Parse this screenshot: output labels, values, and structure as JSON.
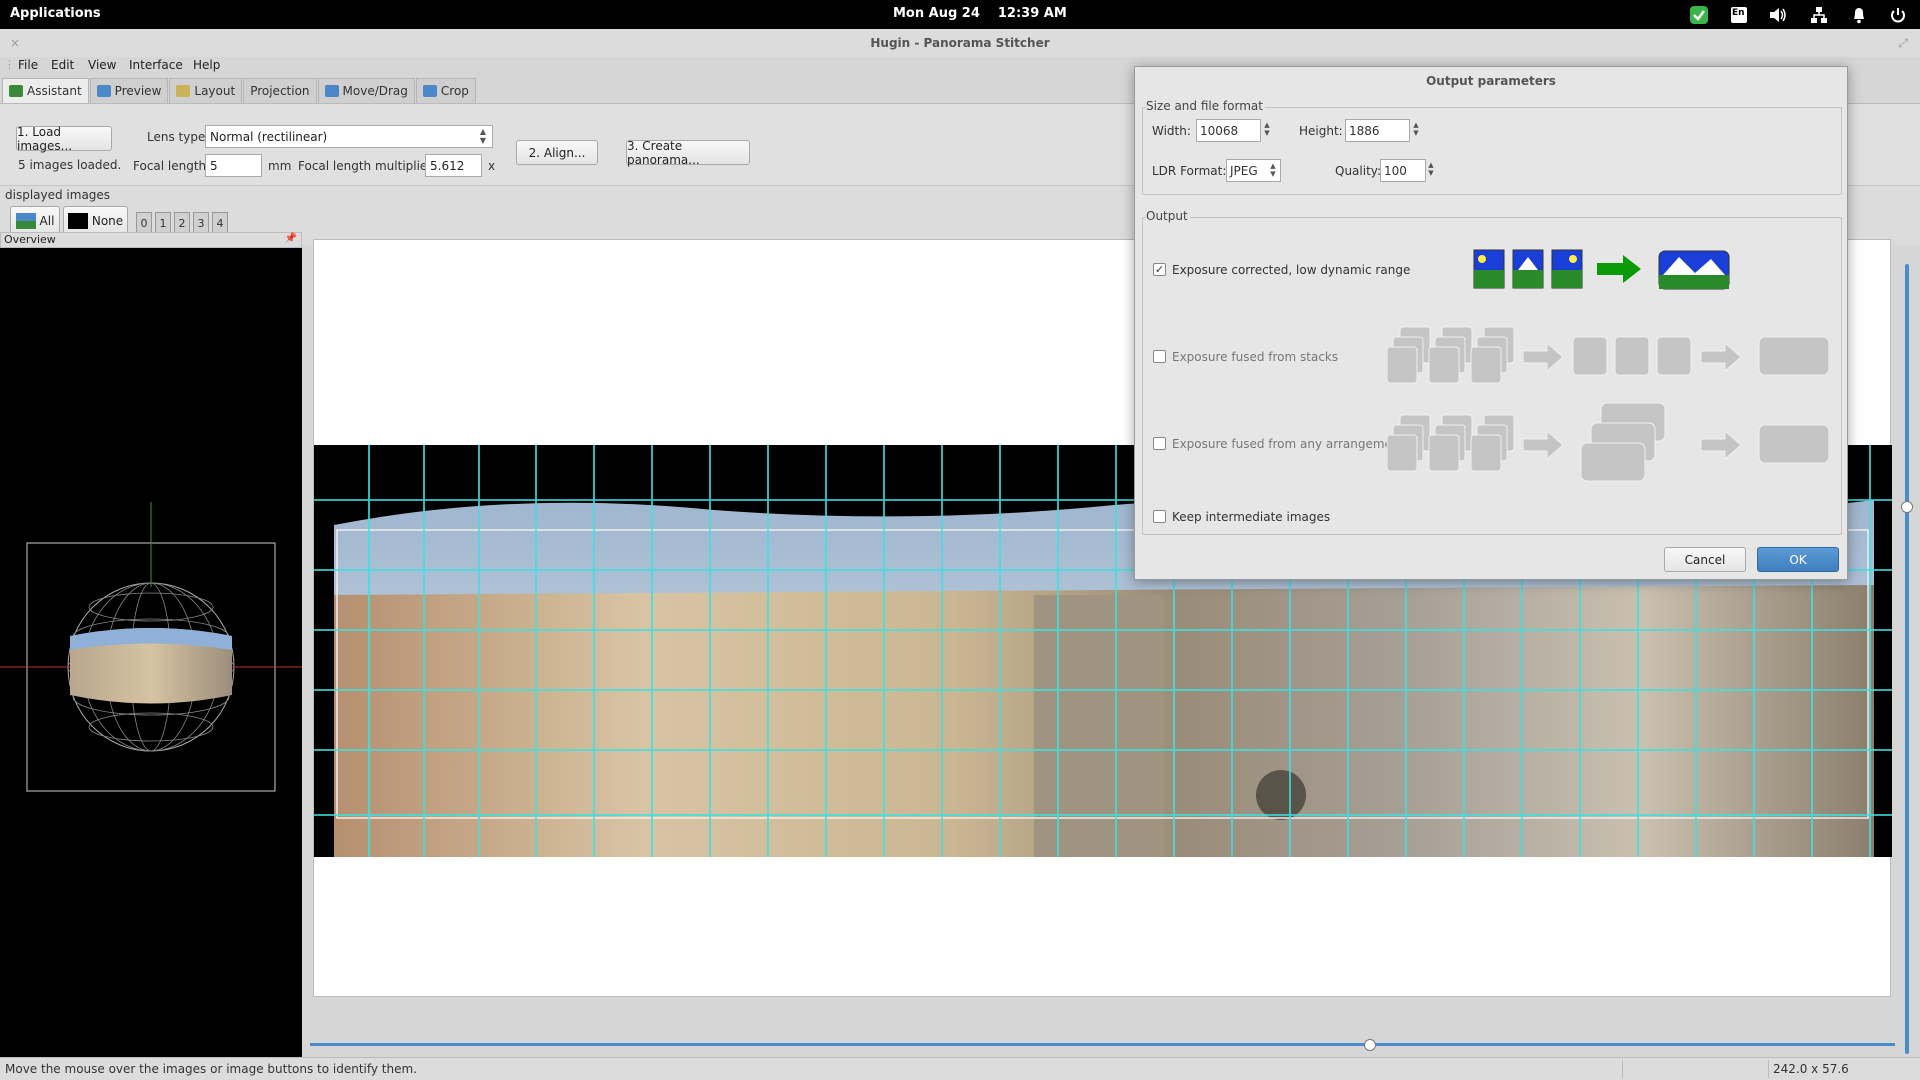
{
  "topbar": {
    "applications": "Applications",
    "date": "Mon Aug 24",
    "time": "12:39 AM",
    "tray": [
      "shield-check-icon",
      "keyboard-layout-icon",
      "volume-icon",
      "network-icon",
      "notification-bell-icon",
      "power-icon"
    ],
    "keyboard_layout": "En"
  },
  "window": {
    "title": "Hugin - Panorama Stitcher"
  },
  "menu": [
    "File",
    "Edit",
    "View",
    "Interface",
    "Help"
  ],
  "tabs": [
    "Assistant",
    "Preview",
    "Layout",
    "Projection",
    "Move/Drag",
    "Crop"
  ],
  "assistant": {
    "load_button": "1. Load images...",
    "images_loaded": "5 images loaded.",
    "lens_type_label": "Lens type:",
    "lens_type_value": "Normal (rectilinear)",
    "focal_length_label": "Focal length:",
    "focal_length_value": "5",
    "focal_length_unit": "mm",
    "multiplier_label": "Focal length multiplier:",
    "multiplier_value": "5.612",
    "multiplier_unit": "x",
    "align_button": "2. Align...",
    "create_button": "3. Create panorama..."
  },
  "displayed_images": {
    "label": "displayed images",
    "all": "All",
    "none": "None",
    "numbers": [
      "0",
      "1",
      "2",
      "3",
      "4"
    ]
  },
  "overview": {
    "title": "Overview"
  },
  "status": {
    "message": "Move the mouse over the images or image buttons to identify them.",
    "fov": "242.0 x 57.6"
  },
  "dialog": {
    "title": "Output parameters",
    "size_group": "Size and file format",
    "width_label": "Width:",
    "width_value": "10068",
    "height_label": "Height:",
    "height_value": "1886",
    "ldr_label": "LDR Format:",
    "ldr_value": "JPEG",
    "quality_label": "Quality:",
    "quality_value": "100",
    "output_group": "Output",
    "option1": "Exposure corrected, low dynamic range",
    "option2": "Exposure fused from stacks",
    "option3": "Exposure fused from any arrangement",
    "option4": "Keep intermediate images",
    "option1_checked": true,
    "cancel": "Cancel",
    "ok": "OK"
  },
  "colors": {
    "accent": "#4a8bc9",
    "grid": "#3fe0e0",
    "ok_button": "#4a8bc9"
  }
}
